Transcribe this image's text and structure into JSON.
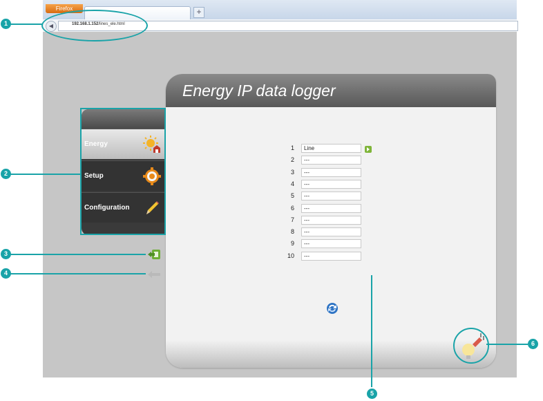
{
  "browser": {
    "app_button": "Firefox",
    "new_tab": "+",
    "url_host": "192.168.1.152",
    "url_path": "/lines_ele.html"
  },
  "panel": {
    "title": "Energy IP data logger"
  },
  "sidebar": {
    "items": [
      {
        "label": "Energy",
        "icon": "sun-house-icon",
        "active": true
      },
      {
        "label": "Setup",
        "icon": "gear-icon",
        "active": false
      },
      {
        "label": "Configuration",
        "icon": "pencil-icon",
        "active": false
      }
    ]
  },
  "lines": [
    {
      "num": "1",
      "value": "Line"
    },
    {
      "num": "2",
      "value": "---"
    },
    {
      "num": "3",
      "value": "---"
    },
    {
      "num": "4",
      "value": "---"
    },
    {
      "num": "5",
      "value": "---"
    },
    {
      "num": "6",
      "value": "---"
    },
    {
      "num": "7",
      "value": "---"
    },
    {
      "num": "8",
      "value": "---"
    },
    {
      "num": "9",
      "value": "---"
    },
    {
      "num": "10",
      "value": "---"
    }
  ],
  "callouts": [
    "1",
    "2",
    "3",
    "4",
    "5",
    "6"
  ],
  "colors": {
    "callout": "#19a3a8",
    "header": "#6e6e6e",
    "page_bg": "#c6c6c6"
  }
}
